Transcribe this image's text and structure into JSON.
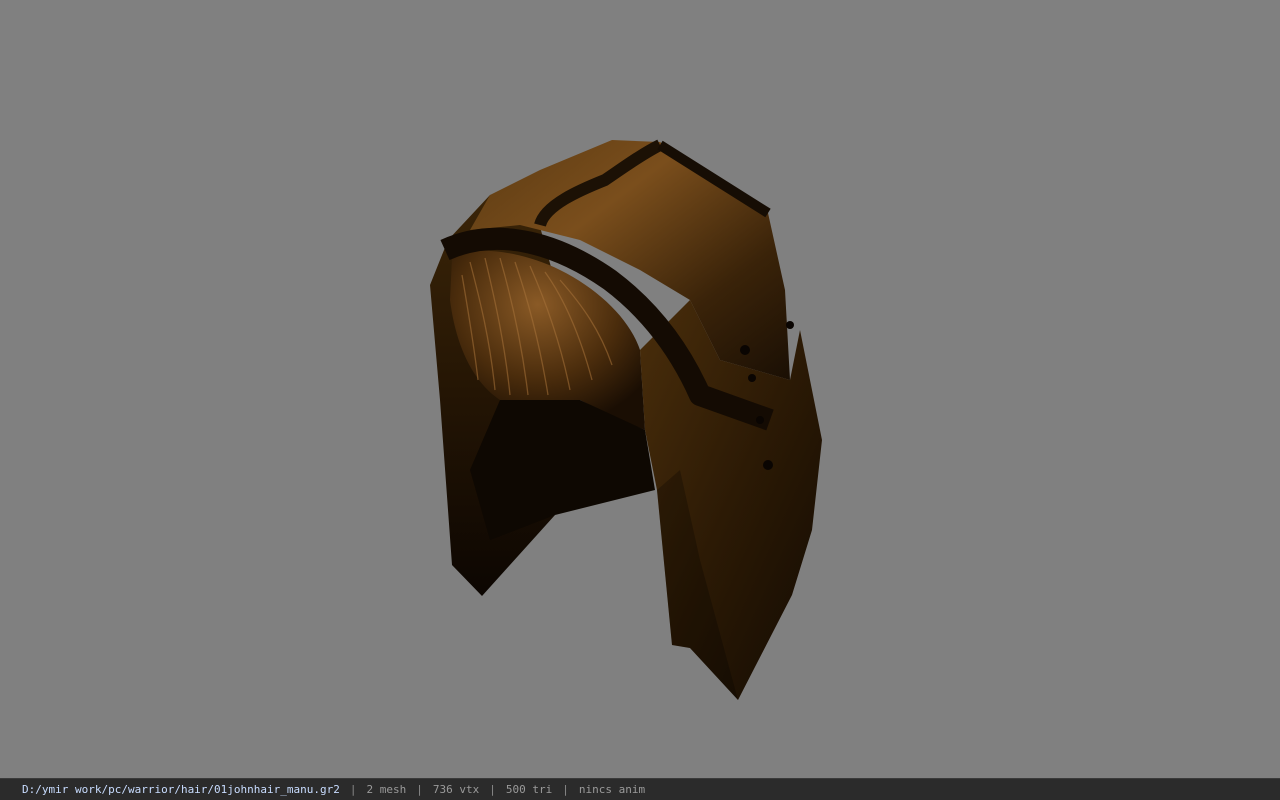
{
  "viewport": {
    "background_color": "#808080",
    "model_colors": {
      "shell_light": "#6a4518",
      "shell_mid": "#3c2409",
      "shell_dark": "#120a03",
      "strap": "#1a1006",
      "hair_texture": "#7a4e1e"
    }
  },
  "statusbar": {
    "file_path": "D:/ymir work/pc/warrior/hair/01johnhair_manu.gr2",
    "separator": "|",
    "mesh_count": "2 mesh",
    "vertex_count": "736 vtx",
    "triangle_count": "500 tri",
    "animation": "nincs anim"
  }
}
